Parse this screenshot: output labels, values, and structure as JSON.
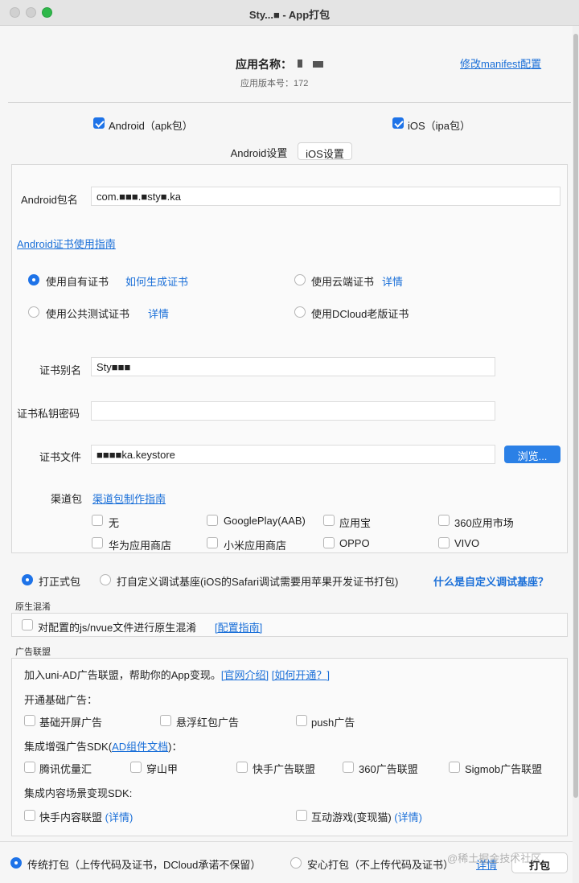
{
  "window": {
    "title": "Sty...■ - App打包"
  },
  "header": {
    "app_name_label": "应用名称：",
    "version_label": "应用版本号：172",
    "manifest_link": "修改manifest配置"
  },
  "platforms": {
    "android": "Android（apk包）",
    "ios": "iOS（ipa包）"
  },
  "tabs": {
    "android": "Android设置",
    "ios": "iOS设置"
  },
  "android": {
    "package_label": "Android包名",
    "package_value": "com.■■■.■sty■.ka",
    "cert_guide_link": "Android证书使用指南",
    "cert_options": {
      "own": "使用自有证书",
      "own_link": "如何生成证书",
      "cloud": "使用云端证书",
      "cloud_link": "详情",
      "public": "使用公共测试证书",
      "public_link": "详情",
      "dcloud": "使用DCloud老版证书"
    },
    "alias_label": "证书别名",
    "alias_value": "Sty■■■",
    "password_label": "证书私钥密码",
    "file_label": "证书文件",
    "file_value": "■■■■ka.keystore",
    "browse_button": "浏览...",
    "channel_label": "渠道包",
    "channel_link": "渠道包制作指南",
    "channels": [
      "无",
      "GooglePlay(AAB)",
      "应用宝",
      "360应用市场",
      "华为应用商店",
      "小米应用商店",
      "OPPO",
      "VIVO"
    ]
  },
  "build_type": {
    "formal": "打正式包",
    "custom": "打自定义调试基座(iOS的Safari调试需要用苹果开发证书打包)",
    "custom_link": "什么是自定义调试基座？"
  },
  "obfuscation": {
    "section": "原生混淆",
    "option": "对配置的js/nvue文件进行原生混淆",
    "guide_link": "[配置指南]"
  },
  "ads": {
    "section": "广告联盟",
    "intro": "加入uni-AD广告联盟，帮助你的App变现。",
    "intro_link1": "[官网介绍]",
    "intro_link2": "[如何开通？]",
    "basic_label": "开通基础广告：",
    "basic": [
      "基础开屏广告",
      "悬浮红包广告",
      "push广告"
    ],
    "enhanced_prefix": "集成增强广告SDK(",
    "enhanced_link": "AD组件文档",
    "enhanced_suffix": ")：",
    "enhanced": [
      "腾讯优量汇",
      "穿山甲",
      "快手广告联盟",
      "360广告联盟",
      "Sigmob广告联盟"
    ],
    "content_label": "集成内容场景变现SDK:",
    "content1": "快手内容联盟",
    "content1_link": "(详情)",
    "content2": "互动游戏(变现猫)",
    "content2_link": "(详情)"
  },
  "footer": {
    "traditional": "传统打包（上传代码及证书，DCloud承诺不保留）",
    "safe": "安心打包（不上传代码及证书）",
    "details_link": "详情",
    "pack_button": "打包",
    "watermark": "@稀土掘金技术社区"
  }
}
